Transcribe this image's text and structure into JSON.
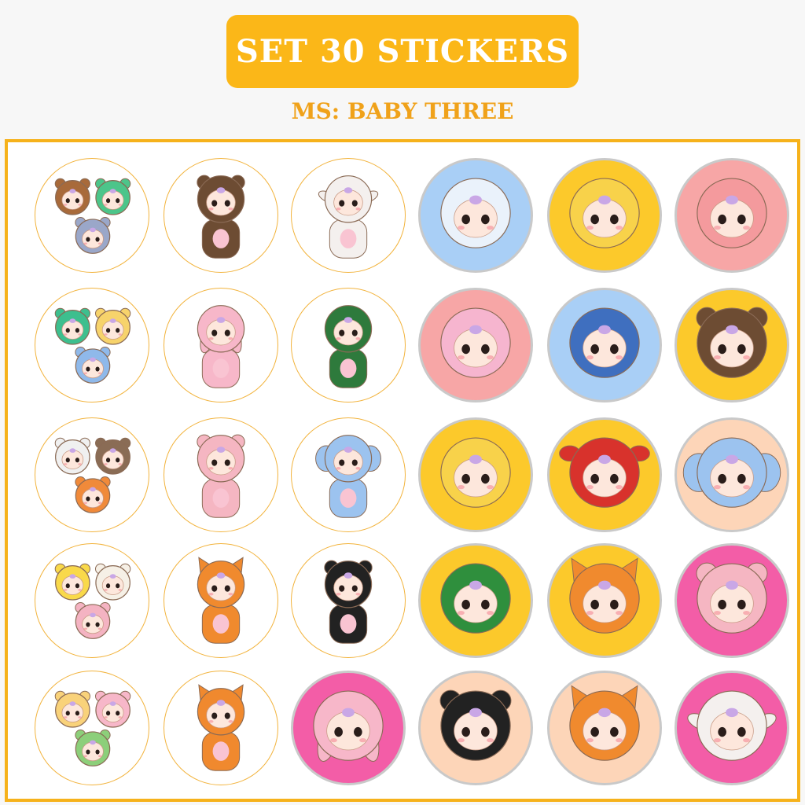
{
  "header": {
    "title": "SET 30 STICKERS",
    "subtitle": "MS: BABY THREE"
  },
  "colors": {
    "accent": "#fbb718",
    "subtitle": "#f0a21a",
    "border": "#f6b21b"
  },
  "stickers": [
    {
      "name": "trio-group-sticker",
      "bg": "#ffffff",
      "costume": "group",
      "c1": "#a86a3a",
      "c2": "#4cc58a",
      "c3": "#9aa7c9"
    },
    {
      "name": "brown-bear-sticker",
      "bg": "#ffffff",
      "costume": "bear",
      "c1": "#6d4c33",
      "c2": "#c98a2e"
    },
    {
      "name": "white-sheep-sticker",
      "bg": "#ffffff",
      "costume": "sheep",
      "c1": "#f4f0ee",
      "c2": "#f6b6c1"
    },
    {
      "name": "seal-sticker",
      "bg": "#a9cff6",
      "costume": "seal",
      "c1": "#eaf2fb",
      "c2": "#a9cff6"
    },
    {
      "name": "yellow-fish-sticker",
      "bg": "#fcc92b",
      "costume": "fish",
      "c1": "#f8d24a",
      "c2": "#e7a51c"
    },
    {
      "name": "pink-chick-sticker",
      "bg": "#f7a6a6",
      "costume": "chick",
      "c1": "#f49a9d",
      "c2": "#d94b4b"
    },
    {
      "name": "trio-dino-sticker",
      "bg": "#ffffff",
      "costume": "group",
      "c1": "#3dbf8e",
      "c2": "#f7d36b",
      "c3": "#8fb9ea"
    },
    {
      "name": "pink-bunny-sticker",
      "bg": "#ffffff",
      "costume": "bunny",
      "c1": "#f7b7c9",
      "c2": "#ffffff"
    },
    {
      "name": "green-dino-sticker",
      "bg": "#ffffff",
      "costume": "dino",
      "c1": "#2e7a3c",
      "c2": "#ffffff"
    },
    {
      "name": "pink-octopus-sticker",
      "bg": "#f7a6a6",
      "costume": "octopus",
      "c1": "#f6b5cf",
      "c2": "#f7a6a6"
    },
    {
      "name": "blue-shark-sticker",
      "bg": "#a9cff6",
      "costume": "shark",
      "c1": "#3f6fbf",
      "c2": "#a9cff6"
    },
    {
      "name": "brown-bear-head-sticker",
      "bg": "#fcc92b",
      "costume": "bear-head",
      "c1": "#6d4c33",
      "c2": "#fcc92b"
    },
    {
      "name": "trio-cow-sticker",
      "bg": "#ffffff",
      "costume": "group",
      "c1": "#f0f0f0",
      "c2": "#8a6c55",
      "c3": "#f08a3a"
    },
    {
      "name": "pink-pig-sticker",
      "bg": "#ffffff",
      "costume": "pig",
      "c1": "#f5b6c2",
      "c2": "#ffffff"
    },
    {
      "name": "blue-elephant-sticker",
      "bg": "#ffffff",
      "costume": "elephant",
      "c1": "#9cc3ef",
      "c2": "#f6a8c5"
    },
    {
      "name": "yellow-anglerfish-sticker",
      "bg": "#fcc92b",
      "costume": "angler",
      "c1": "#f8d24a",
      "c2": "#e7a51c"
    },
    {
      "name": "red-crab-sticker",
      "bg": "#fcc92b",
      "costume": "crab",
      "c1": "#d8322c",
      "c2": "#fcc92b"
    },
    {
      "name": "blue-elephant-head-sticker",
      "bg": "#fdd5b8",
      "costume": "elephant-head",
      "c1": "#9cc3ef",
      "c2": "#fdd5b8"
    },
    {
      "name": "trio-chick-sticker",
      "bg": "#ffffff",
      "costume": "group",
      "c1": "#f9d94a",
      "c2": "#f6f0e6",
      "c3": "#f4b3c2"
    },
    {
      "name": "orange-fox-sticker",
      "bg": "#ffffff",
      "costume": "fox",
      "c1": "#f08a2e",
      "c2": "#ffffff"
    },
    {
      "name": "panda-sticker",
      "bg": "#ffffff",
      "costume": "panda",
      "c1": "#222222",
      "c2": "#ffffff"
    },
    {
      "name": "green-dino-head-sticker",
      "bg": "#fcc92b",
      "costume": "dino-head",
      "c1": "#2f8f3d",
      "c2": "#fcc92b"
    },
    {
      "name": "fox-head-sticker",
      "bg": "#fcc92b",
      "costume": "fox-head",
      "c1": "#f08a2e",
      "c2": "#fcc92b"
    },
    {
      "name": "pink-pig-head-sticker",
      "bg": "#f35da7",
      "costume": "pig-head",
      "c1": "#f5b6c2",
      "c2": "#f35da7"
    },
    {
      "name": "trio-bunny-sticker",
      "bg": "#ffffff",
      "costume": "group",
      "c1": "#f9d27a",
      "c2": "#f7b7c9",
      "c3": "#8ccf7a"
    },
    {
      "name": "orange-fox-2-sticker",
      "bg": "#ffffff",
      "costume": "fox",
      "c1": "#f0892e",
      "c2": "#ffffff"
    },
    {
      "name": "pink-bunny-head-sticker",
      "bg": "#f35da7",
      "costume": "bunny-head",
      "c1": "#f7b7c9",
      "c2": "#f35da7"
    },
    {
      "name": "panda-head-sticker",
      "bg": "#fdd5b8",
      "costume": "panda-head",
      "c1": "#222222",
      "c2": "#fdd5b8"
    },
    {
      "name": "orange-fox-head-sticker",
      "bg": "#fdd5b8",
      "costume": "fox-head",
      "c1": "#f08a2e",
      "c2": "#fdd5b8"
    },
    {
      "name": "white-sheep-head-sticker",
      "bg": "#f35da7",
      "costume": "sheep-head",
      "c1": "#f4f0ee",
      "c2": "#f35da7"
    }
  ]
}
